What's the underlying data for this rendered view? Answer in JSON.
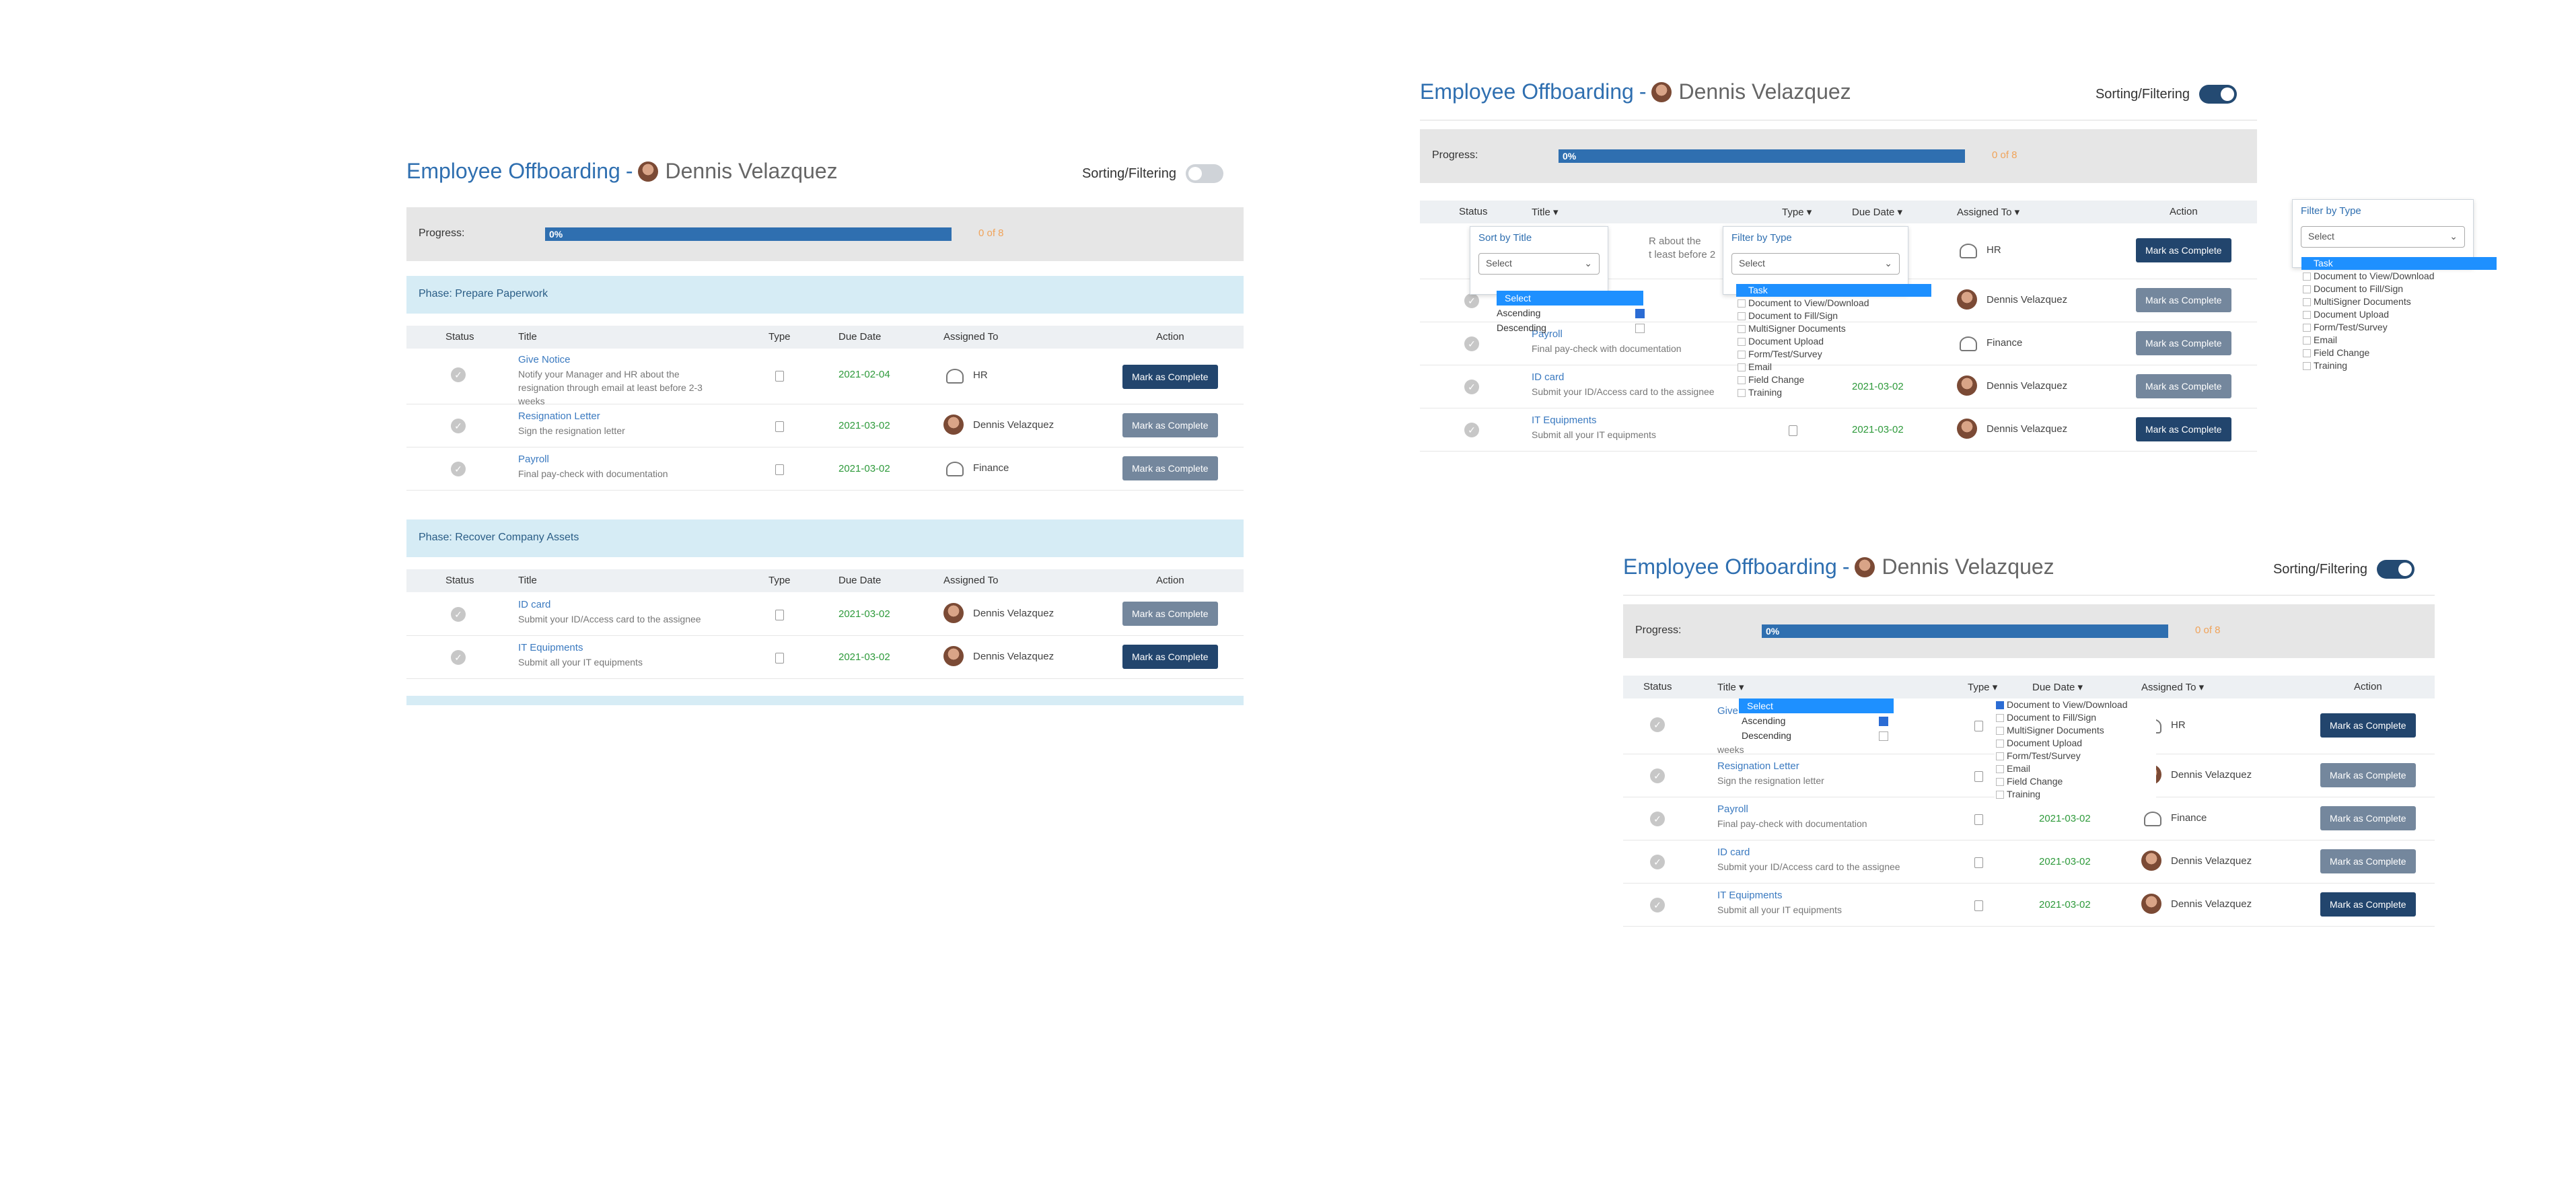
{
  "page": {
    "title": "Employee Offboarding",
    "dash": "-",
    "employee": "Dennis Velazquez",
    "sorting_label": "Sorting/Filtering"
  },
  "progress": {
    "label": "Progress:",
    "percent_text": "0%",
    "count_text": "0 of 8",
    "value": 0
  },
  "columns": {
    "status": "Status",
    "title": "Title",
    "type": "Type",
    "due": "Due Date",
    "assigned": "Assigned To",
    "action": "Action"
  },
  "phases": [
    {
      "name": "Phase: Prepare Paperwork",
      "tasks": [
        {
          "title": "Give Notice",
          "desc1": "Notify your Manager and HR about the",
          "desc2": "resignation through email at least before 2-3",
          "desc3": "weeks",
          "due": "2021-02-04",
          "assigned": "HR",
          "action": "Mark as Complete"
        },
        {
          "title": "Resignation Letter",
          "desc1": "Sign the resignation letter",
          "due": "2021-03-02",
          "assigned": "Dennis Velazquez",
          "action": "Mark as Complete"
        },
        {
          "title": "Payroll",
          "desc1": "Final pay-check with documentation",
          "due": "2021-03-02",
          "assigned": "Finance",
          "action": "Mark as Complete"
        }
      ]
    },
    {
      "name": "Phase: Recover Company Assets",
      "tasks": [
        {
          "title": "ID card",
          "desc1": "Submit your ID/Access card to the assignee",
          "due": "2021-03-02",
          "assigned": "Dennis Velazquez",
          "action": "Mark as Complete"
        },
        {
          "title": "IT Equipments",
          "desc1": "Submit all your IT equipments",
          "due": "2021-03-02",
          "assigned": "Dennis Velazquez",
          "action": "Mark as Complete"
        }
      ]
    }
  ],
  "sort_popup": {
    "heading": "Sort by Title",
    "select": "Select",
    "options": [
      "Select",
      "Ascending",
      "Descending"
    ]
  },
  "filter_popup": {
    "heading": "Filter by Type",
    "select": "Select",
    "options": [
      "Task",
      "Document to View/Download",
      "Document to Fill/Sign",
      "MultiSigner Documents",
      "Document Upload",
      "Form/Test/Survey",
      "Email",
      "Field Change",
      "Training"
    ]
  },
  "colors": {
    "accent": "#2f6fb0",
    "dark_button": "#22456d",
    "grey_button": "#74879d",
    "due": "#2e9a3b",
    "count": "#f0a35a"
  }
}
